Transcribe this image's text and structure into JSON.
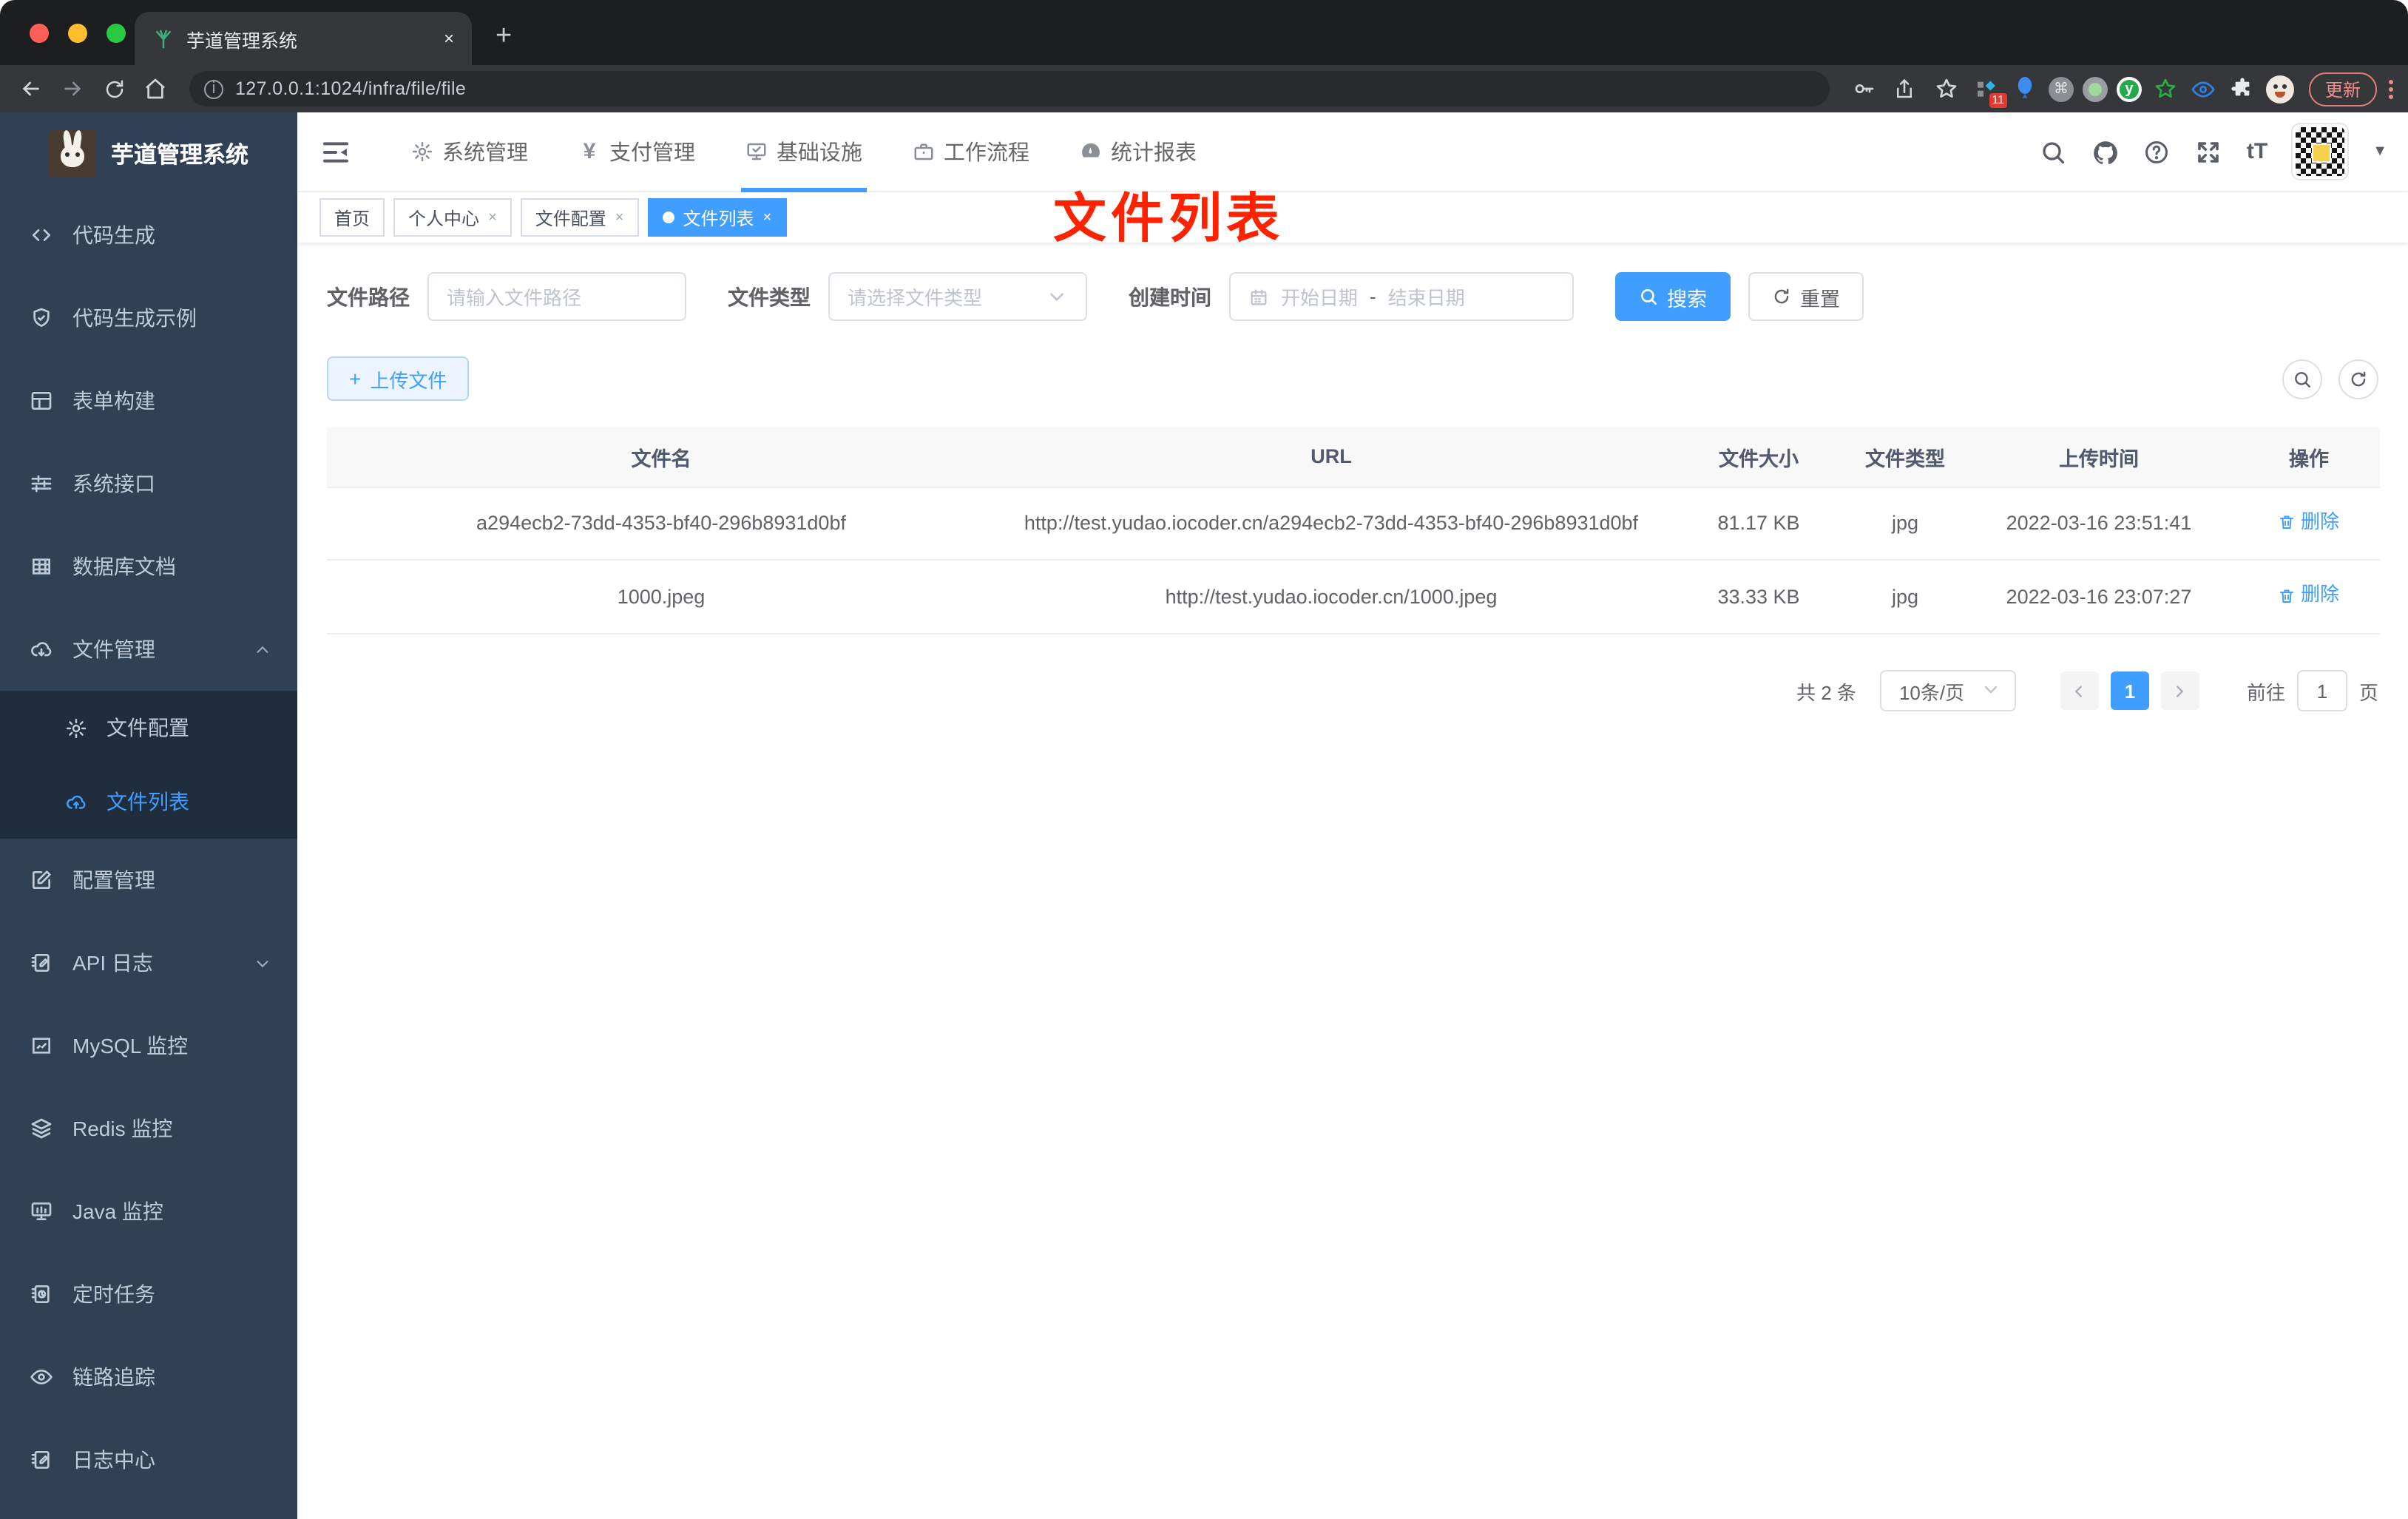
{
  "browser": {
    "tab_title": "芋道管理系统",
    "close_tab": "×",
    "new_tab": "+",
    "url": "127.0.0.1:1024/infra/file/file",
    "extension_badge": "11",
    "cmd_glyph": "⌘",
    "y_glyph": "y",
    "update_label": "更新"
  },
  "logo": {
    "title": "芋道管理系统"
  },
  "topnav": {
    "items": [
      {
        "label": "系统管理",
        "icon": "gear-icon",
        "active": false
      },
      {
        "label": "支付管理",
        "icon": "yen-icon",
        "active": false
      },
      {
        "label": "基础设施",
        "icon": "infra-monitor-icon",
        "active": true
      },
      {
        "label": "工作流程",
        "icon": "briefcase-icon",
        "active": false
      },
      {
        "label": "统计报表",
        "icon": "gauge-icon",
        "active": false
      }
    ]
  },
  "header_icons": [
    "search-icon",
    "github-icon",
    "help-icon",
    "fullscreen-icon",
    "font-size-icon",
    "avatar-qr",
    "caret-down-icon"
  ],
  "font_size_icon_label": "tT",
  "sidebar": {
    "items": [
      {
        "label": "代码生成",
        "icon": "code-icon"
      },
      {
        "label": "代码生成示例",
        "icon": "shield-check-icon"
      },
      {
        "label": "表单构建",
        "icon": "form-grid-icon"
      },
      {
        "label": "系统接口",
        "icon": "sliders-icon"
      },
      {
        "label": "数据库文档",
        "icon": "table-filled-icon"
      },
      {
        "label": "文件管理",
        "icon": "cloud-download-icon",
        "expanded": true,
        "children": [
          {
            "label": "文件配置",
            "icon": "gear-icon",
            "active": false
          },
          {
            "label": "文件列表",
            "icon": "cloud-upload-icon",
            "active": true
          }
        ]
      },
      {
        "label": "配置管理",
        "icon": "edit-square-icon"
      },
      {
        "label": "API 日志",
        "icon": "doc-edit-icon",
        "collapsed": true
      },
      {
        "label": "MySQL 监控",
        "icon": "chart-icon"
      },
      {
        "label": "Redis 监控",
        "icon": "layers-icon"
      },
      {
        "label": "Java 监控",
        "icon": "monitor-icon"
      },
      {
        "label": "定时任务",
        "icon": "timer-doc-icon"
      },
      {
        "label": "链路追踪",
        "icon": "eye-icon"
      },
      {
        "label": "日志中心",
        "icon": "doc-edit-icon"
      }
    ]
  },
  "tags": [
    {
      "label": "首页",
      "closable": false,
      "active": false
    },
    {
      "label": "个人中心",
      "closable": true,
      "active": false
    },
    {
      "label": "文件配置",
      "closable": true,
      "active": false
    },
    {
      "label": "文件列表",
      "closable": true,
      "active": true
    }
  ],
  "close_glyph": "×",
  "annotation": {
    "text": "文件列表",
    "color": "#ff2200"
  },
  "filter": {
    "path_label": "文件路径",
    "path_placeholder": "请输入文件路径",
    "type_label": "文件类型",
    "type_placeholder": "请选择文件类型",
    "time_label": "创建时间",
    "start_placeholder": "开始日期",
    "range_separator": "-",
    "end_placeholder": "结束日期",
    "search_label": "搜索",
    "reset_label": "重置"
  },
  "toolbar": {
    "upload_label": "上传文件",
    "plus_glyph": "+"
  },
  "table": {
    "headers": [
      "文件名",
      "URL",
      "文件大小",
      "文件类型",
      "上传时间",
      "操作"
    ],
    "rows": [
      {
        "name": "a294ecb2-73dd-4353-bf40-296b8931d0bf",
        "url": "http://test.yudao.iocoder.cn/a294ecb2-73dd-4353-bf40-296b8931d0bf",
        "size": "81.17 KB",
        "type": "jpg",
        "time": "2022-03-16 23:51:41"
      },
      {
        "name": "1000.jpeg",
        "url": "http://test.yudao.iocoder.cn/1000.jpeg",
        "size": "33.33 KB",
        "type": "jpg",
        "time": "2022-03-16 23:07:27"
      }
    ],
    "delete_label": "删除"
  },
  "pagination": {
    "total_label": "共 2 条",
    "page_size": "10条/页",
    "current_page": "1",
    "goto_label": "前往",
    "goto_value": "1",
    "page_unit": "页"
  },
  "colors": {
    "accent": "#409eff",
    "sidebar_bg": "#304156",
    "submenu_bg": "#1f2d3d"
  }
}
